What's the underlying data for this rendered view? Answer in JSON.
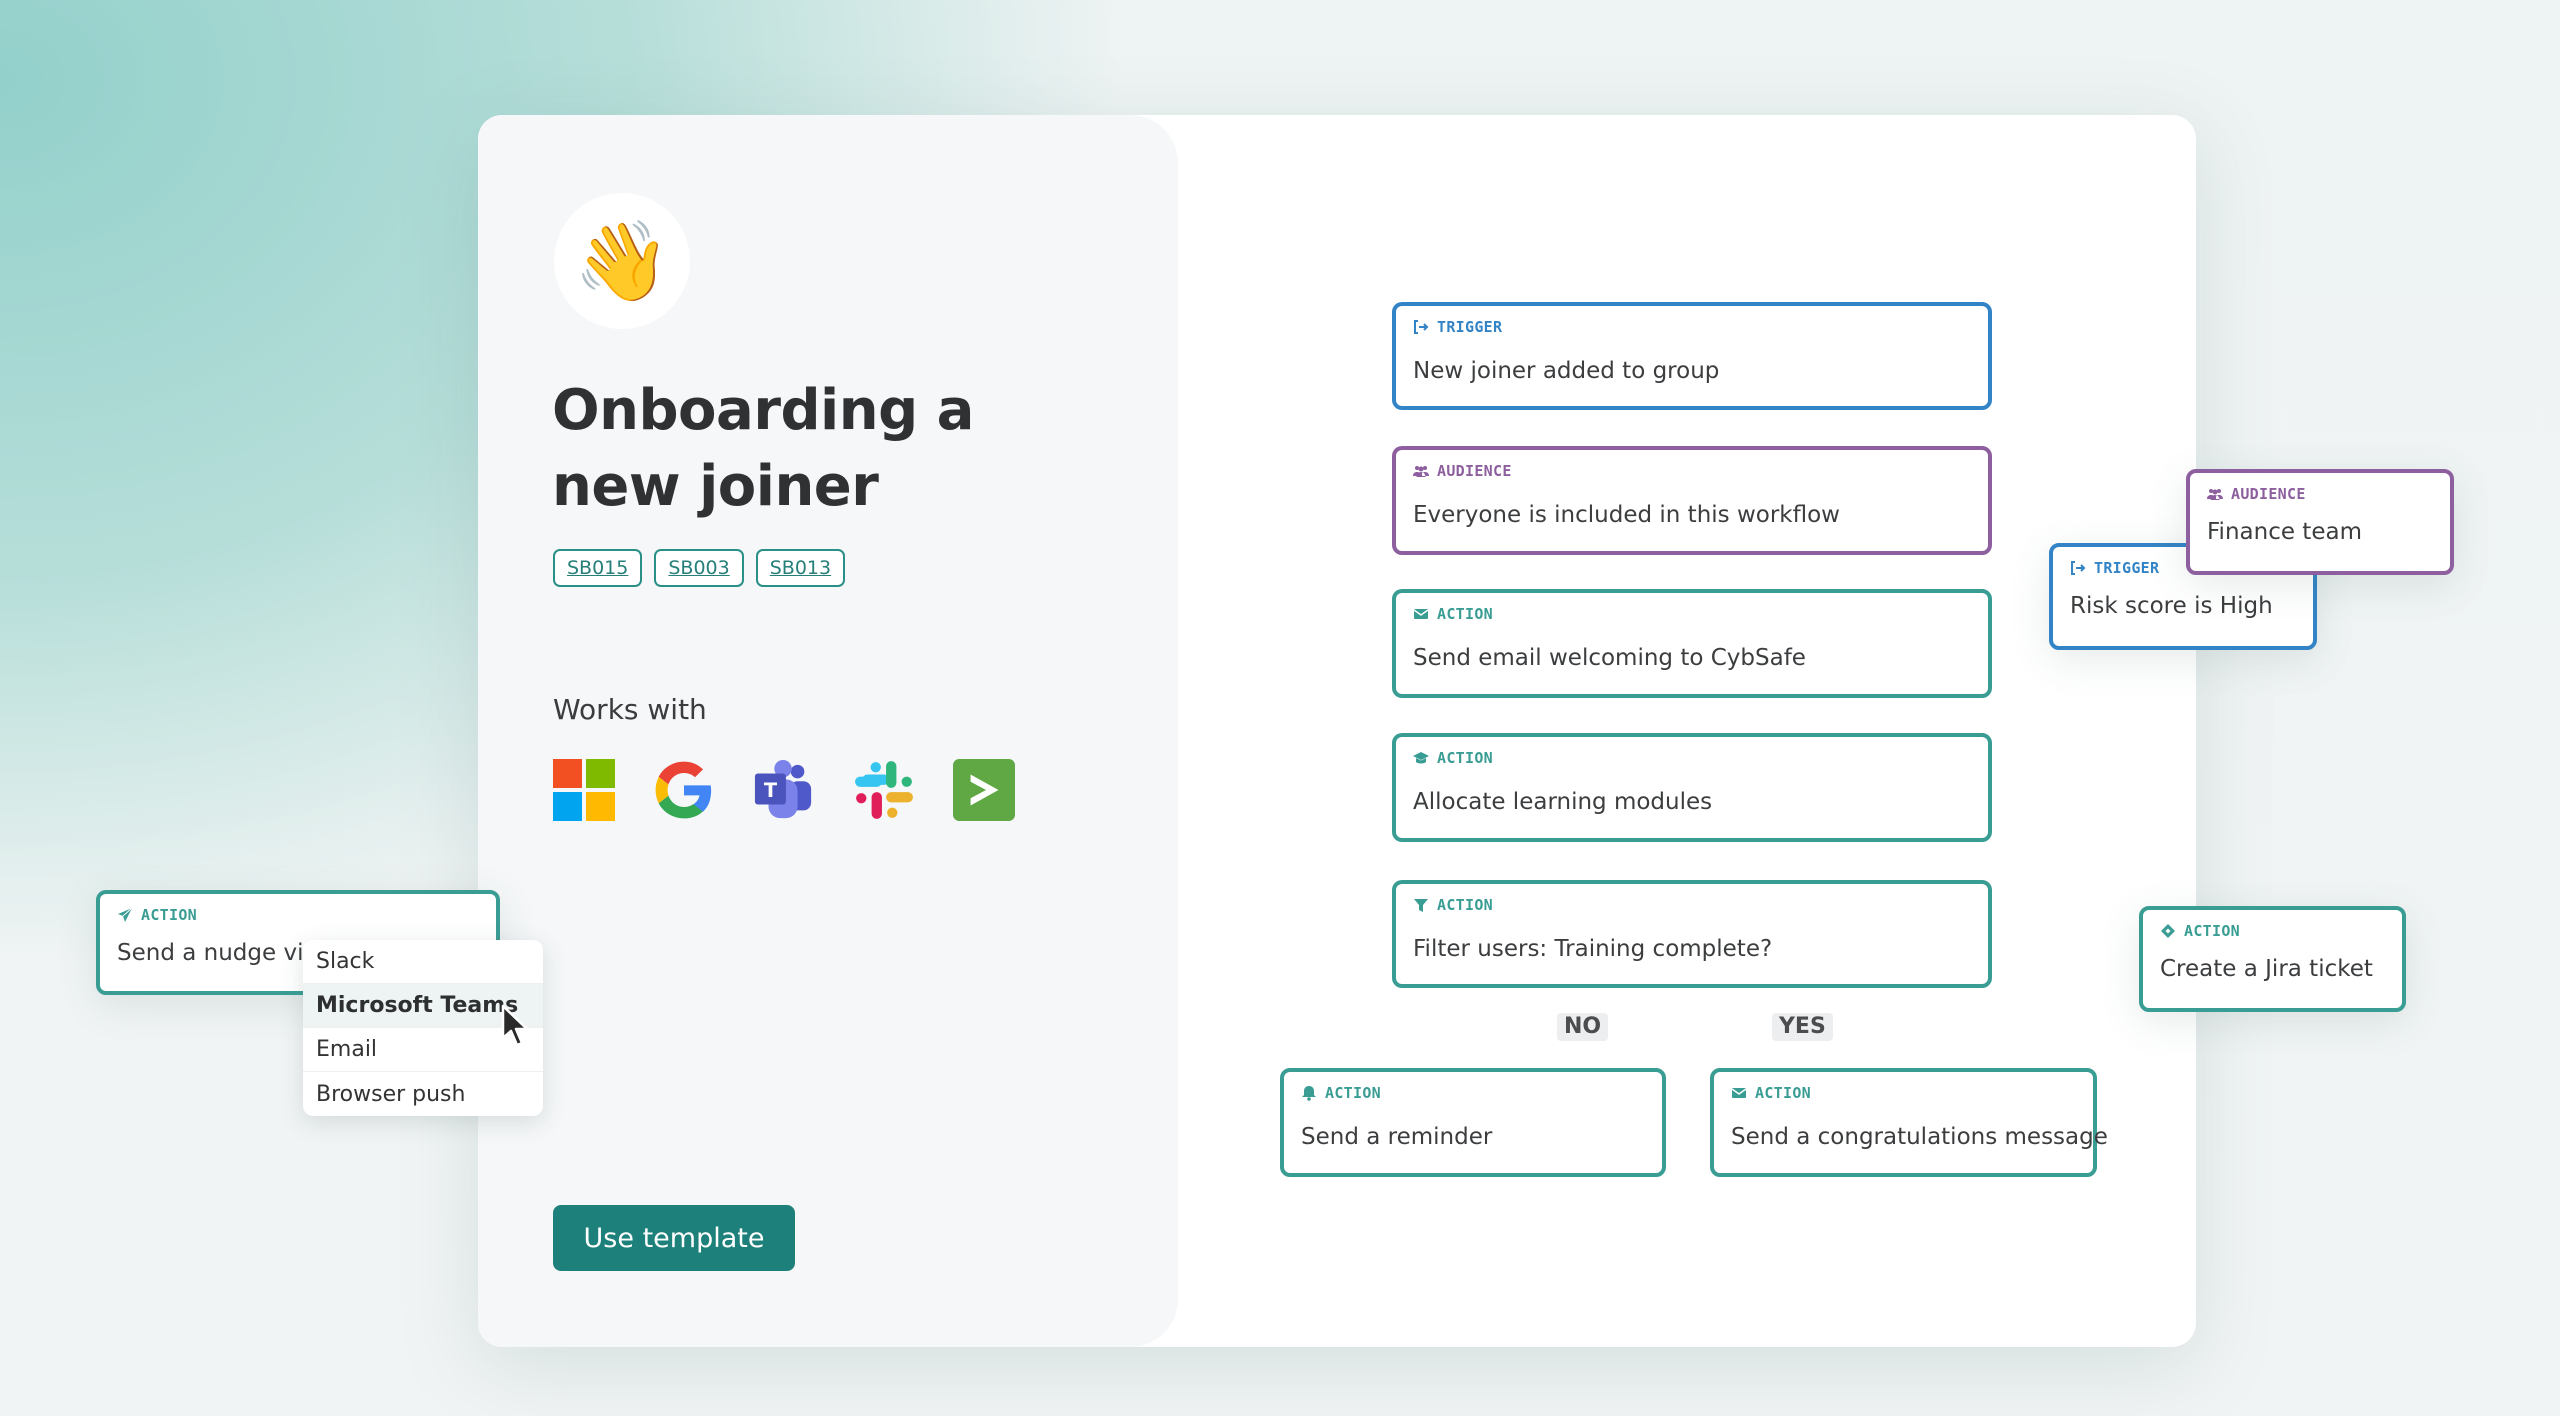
{
  "template": {
    "emoji": "👋",
    "title": "Onboarding a new joiner",
    "tags": [
      "SB015",
      "SB003",
      "SB013"
    ],
    "works_with_label": "Works with",
    "integrations": [
      "microsoft-logo",
      "google-logo",
      "microsoft-teams-logo",
      "slack-logo",
      "splashtop-logo"
    ],
    "use_template_label": "Use template"
  },
  "workflow": {
    "nodes": [
      {
        "type": "TRIGGER",
        "icon": "sign-in-icon",
        "text": "New joiner added to group"
      },
      {
        "type": "AUDIENCE",
        "icon": "users-icon",
        "text": "Everyone is included in this workflow"
      },
      {
        "type": "ACTION",
        "icon": "envelope-icon",
        "text": "Send email welcoming to CybSafe"
      },
      {
        "type": "ACTION",
        "icon": "graduation-cap-icon",
        "text": "Allocate learning modules"
      },
      {
        "type": "ACTION",
        "icon": "filter-icon",
        "text": "Filter users: Training complete?"
      }
    ],
    "branches": {
      "no_label": "NO",
      "yes_label": "YES",
      "no_node": {
        "type": "ACTION",
        "icon": "bell-icon",
        "text": "Send a reminder"
      },
      "yes_node": {
        "type": "ACTION",
        "icon": "envelope-icon",
        "text": "Send a congratulations message"
      }
    }
  },
  "floating_cards": {
    "audience": {
      "type": "AUDIENCE",
      "text": "Finance team"
    },
    "trigger": {
      "type": "TRIGGER",
      "text": "Risk score is High"
    },
    "jira": {
      "type": "ACTION",
      "text": "Create a Jira ticket"
    },
    "nudge": {
      "type": "ACTION",
      "text": "Send a nudge via",
      "options": [
        "Slack",
        "Microsoft Teams",
        "Email",
        "Browser push"
      ],
      "highlighted_option": "Microsoft Teams"
    }
  },
  "colors": {
    "accent": "#1e807a",
    "action": "#3a9d94",
    "trigger": "#3384c6",
    "audience": "#8d5f9e"
  }
}
